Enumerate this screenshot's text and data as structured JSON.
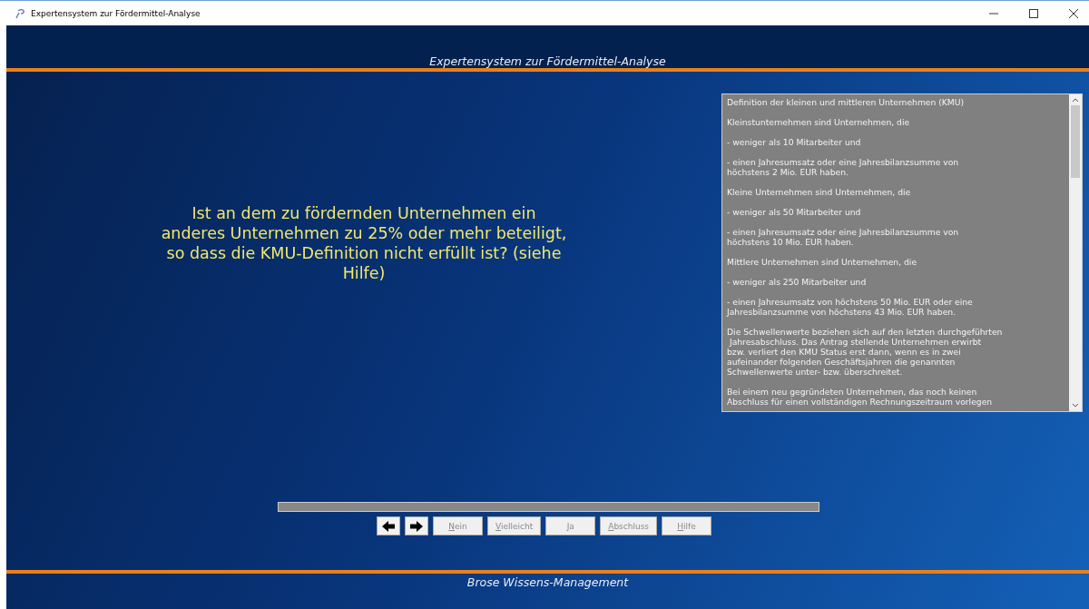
{
  "window": {
    "title": "Expertensystem zur Fördermittel-Analyse"
  },
  "header": {
    "title": "Expertensystem zur Fördermittel-Analyse"
  },
  "question": "Ist an dem zu fördernden Unternehmen ein anderes Unternehmen zu 25% oder mehr beteiligt, so dass die KMU-Definition nicht erfüllt ist? (siehe Hilfe)",
  "help_text": [
    [
      "Definition der kleinen und mittleren Unternehmen (KMU)"
    ],
    [
      "Kleinstunternehmen sind Unternehmen, die"
    ],
    [
      "- weniger als 10 Mitarbeiter und"
    ],
    [
      "- einen Jahresumsatz oder eine Jahresbilanzsumme von",
      "höchstens 2 Mio. EUR haben."
    ],
    [
      "Kleine Unternehmen sind Unternehmen, die"
    ],
    [
      "- weniger als 50 Mitarbeiter und"
    ],
    [
      "- einen Jahresumsatz oder eine Jahresbilanzsumme von",
      "höchstens 10 Mio. EUR haben."
    ],
    [
      "Mittlere Unternehmen sind Unternehmen, die"
    ],
    [
      "- weniger als 250 Mitarbeiter und"
    ],
    [
      "- einen Jahresumsatz von höchstens 50 Mio. EUR oder eine",
      "Jahresbilanzsumme von höchstens 43 Mio. EUR haben."
    ],
    [
      "Die Schwellenwerte beziehen sich auf den letzten durchgeführten",
      " Jahresabschluss. Das Antrag stellende Unternehmen erwirbt",
      "bzw. verliert den KMU Status erst dann, wenn es in zwei",
      "aufeinander folgenden Geschäftsjahren die genannten",
      "Schwellenwerte unter- bzw. überschreitet."
    ],
    [
      "Bei einem neu gegründeten Unternehmen, das noch keinen",
      "Abschluss für einen vollständigen Rechnungszeitraum vorlegen"
    ]
  ],
  "progress": {
    "level": 1
  },
  "nav_buttons": [
    {
      "kind": "back"
    },
    {
      "kind": "forward"
    }
  ],
  "answer_buttons": [
    {
      "label": "Nein",
      "disabled": true
    },
    {
      "label": "Vielleicht",
      "disabled": true
    },
    {
      "label": "Ja",
      "disabled": true
    },
    {
      "label": "Abschluss",
      "disabled": true
    },
    {
      "label": "Hilfe",
      "disabled": true
    }
  ],
  "footer": {
    "text": "Brose Wissens-Management"
  }
}
